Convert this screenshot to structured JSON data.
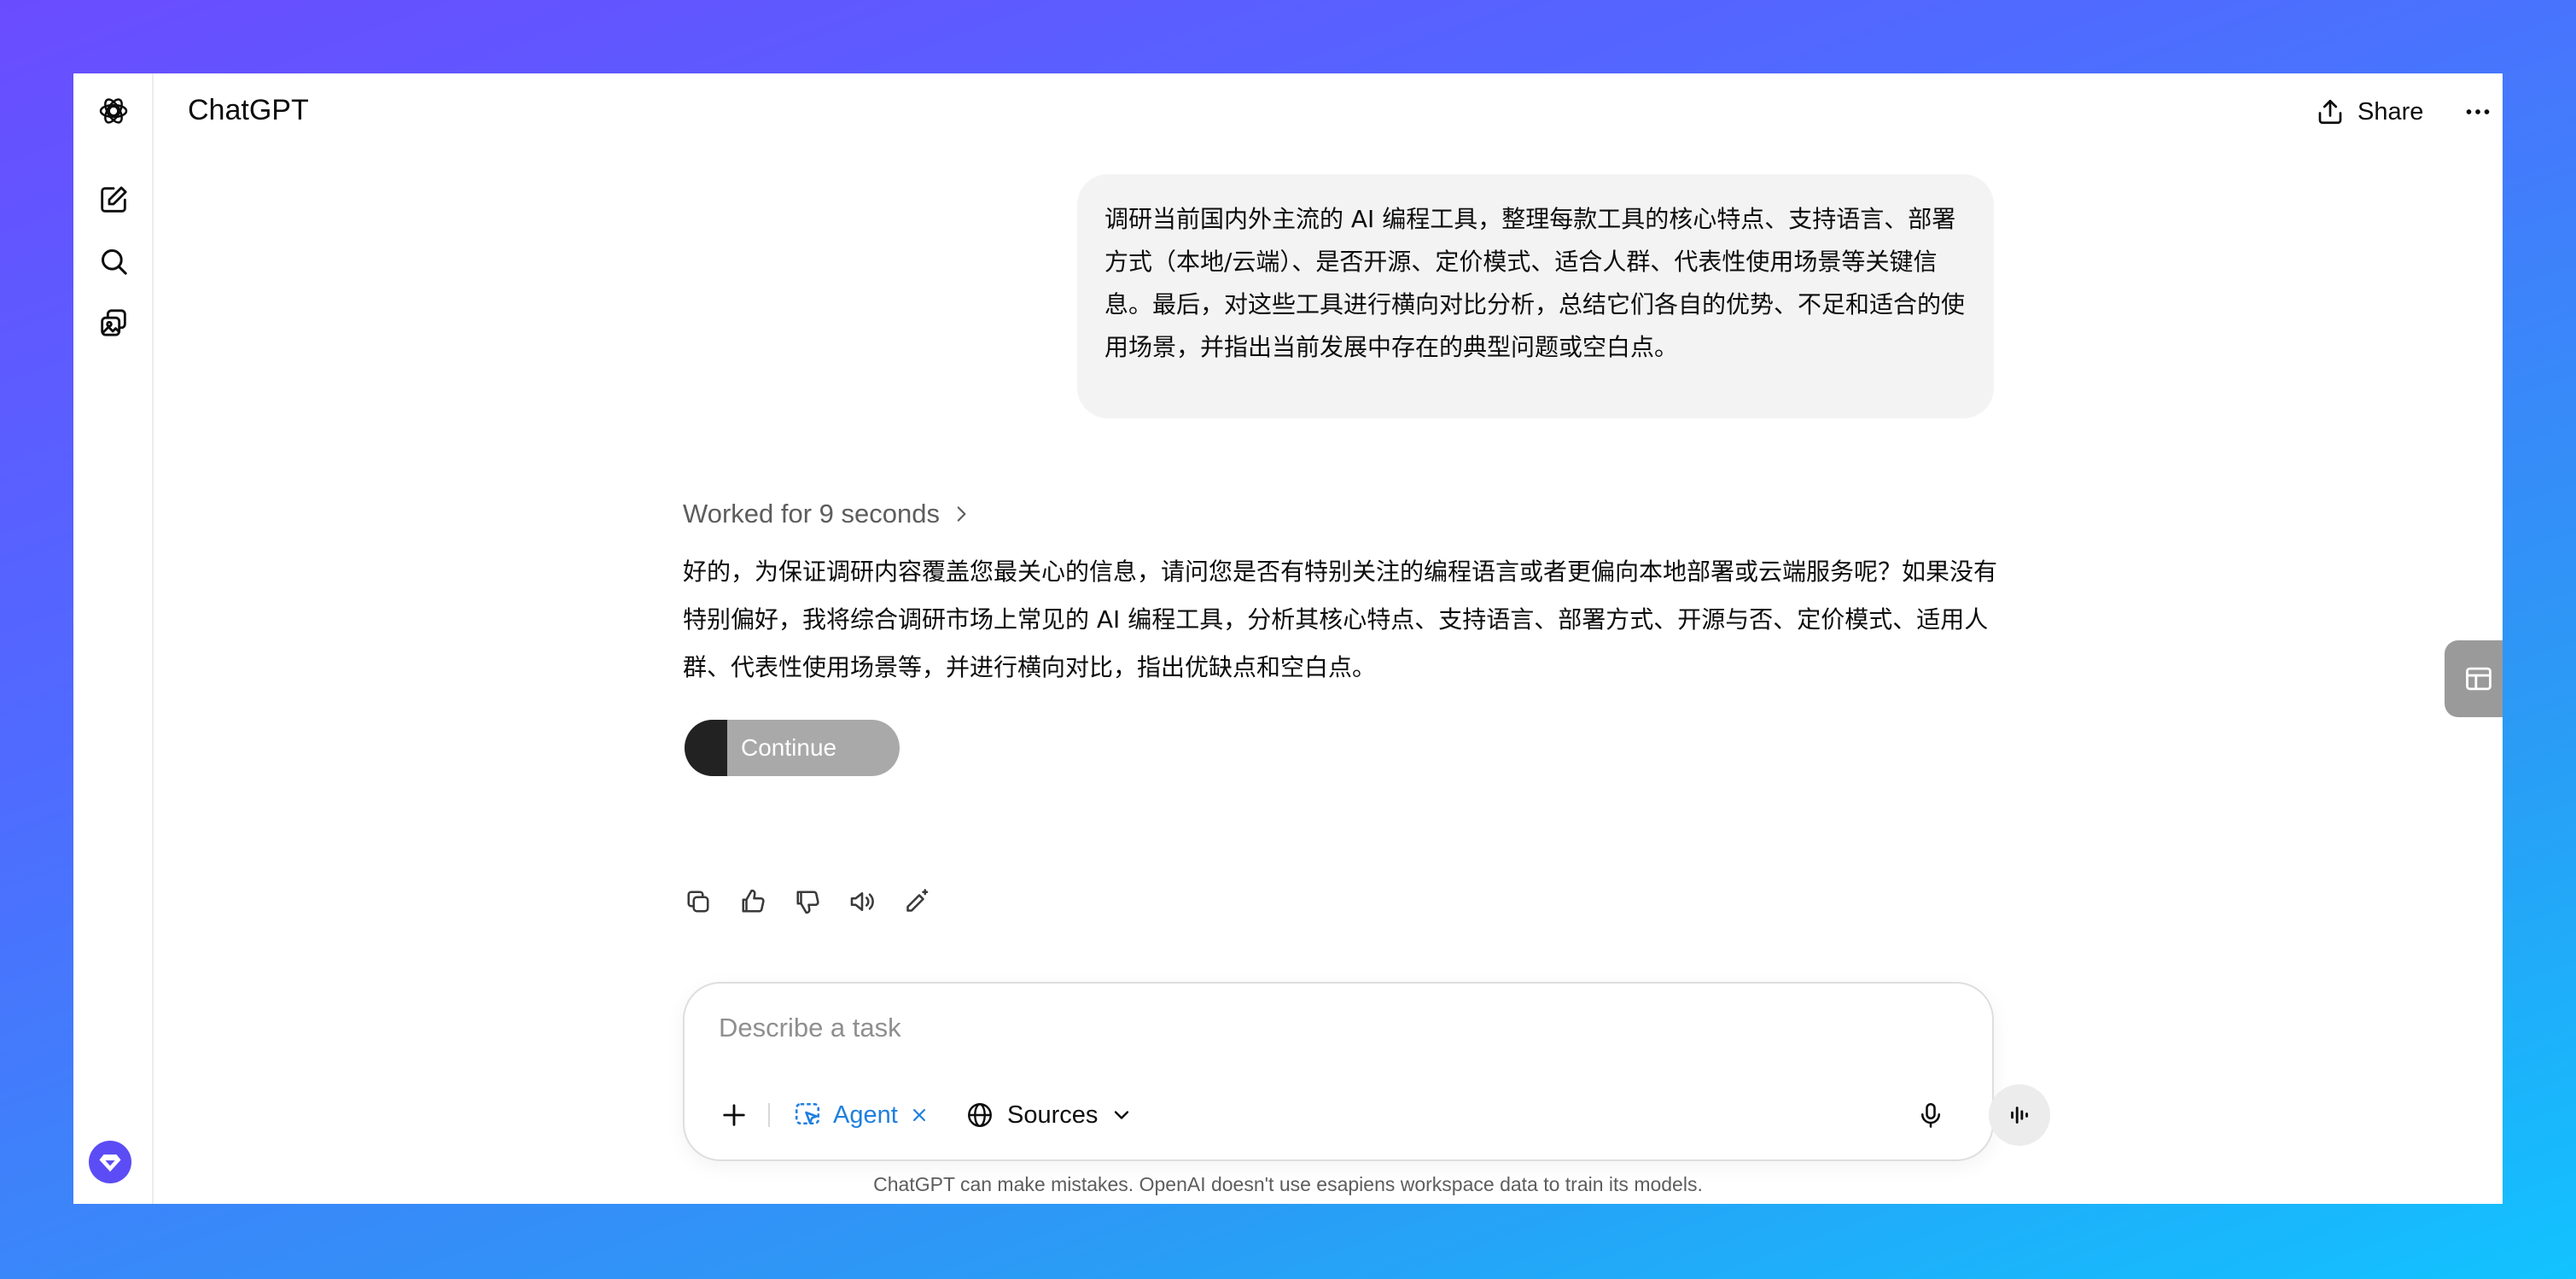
{
  "app": {
    "title": "ChatGPT"
  },
  "header": {
    "share_label": "Share"
  },
  "conversation": {
    "user_message": "调研当前国内外主流的 AI 编程工具，整理每款工具的核心特点、支持语言、部署方式（本地/云端）、是否开源、定价模式、适合人群、代表性使用场景等关键信息。最后，对这些工具进行横向对比分析，总结它们各自的优势、不足和适合的使用场景，并指出当前发展中存在的典型问题或空白点。",
    "worked_label": "Worked for 9 seconds",
    "assistant_message": "好的，为保证调研内容覆盖您最关心的信息，请问您是否有特别关注的编程语言或者更偏向本地部署或云端服务呢？如果没有特别偏好，我将综合调研市场上常见的 AI 编程工具，分析其核心特点、支持语言、部署方式、开源与否、定价模式、适用人群、代表性使用场景等，并进行横向对比，指出优缺点和空白点。",
    "continue_label": "Continue"
  },
  "composer": {
    "placeholder": "Describe a task",
    "agent_label": "Agent",
    "sources_label": "Sources"
  },
  "footer": {
    "disclaimer": "ChatGPT can make mistakes. OpenAI doesn't use esapiens workspace data to train its models."
  },
  "colors": {
    "accent": "#1e7fe0",
    "upgrade": "#5b4cf5",
    "bubble": "#f3f3f3"
  }
}
